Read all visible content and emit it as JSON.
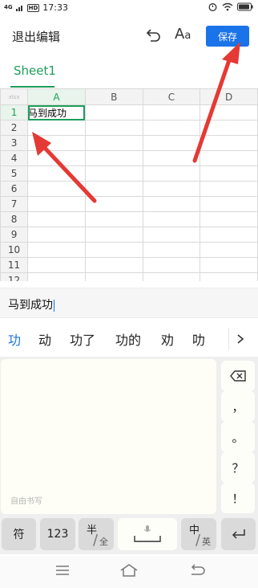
{
  "status_bar": {
    "network_label": "4G",
    "hd_label": "HD",
    "time": "17:33"
  },
  "toolbar": {
    "exit_label": "退出编辑",
    "font_label_big": "A",
    "font_label_small": "a",
    "save_label": "保存"
  },
  "sheet_tabs": [
    {
      "label": "Sheet1",
      "active": true
    }
  ],
  "grid": {
    "corner_label": "xlsx",
    "columns": [
      "A",
      "B",
      "C",
      "D"
    ],
    "rows": [
      "1",
      "2",
      "3",
      "4",
      "5",
      "6",
      "7",
      "8",
      "9",
      "10",
      "11",
      "12"
    ],
    "active_cell": "A1",
    "cells": {
      "A1": "马到成功"
    }
  },
  "formula_bar": {
    "value": "马到成功"
  },
  "keyboard": {
    "candidates": [
      "功",
      "动",
      "功了",
      "功的",
      "劝",
      "叻"
    ],
    "candidate_highlight_color": "#1a73e8",
    "more_icon": "chevron-right-icon",
    "handwriting_hint": "自由书写",
    "side_keys": [
      "，",
      "。",
      "？",
      "！"
    ],
    "backspace_icon": "backspace-icon",
    "bottom_row": {
      "symbol_label": "符",
      "number_label": "123",
      "half_label": "半",
      "full_label": "全",
      "space_icon": "microphone-icon",
      "zh_label": "中",
      "en_label": "英",
      "enter_icon": "enter-icon"
    }
  },
  "colors": {
    "accent_green": "#1e9e5a",
    "save_blue": "#1a73e8",
    "arrow_red": "#e53935"
  }
}
